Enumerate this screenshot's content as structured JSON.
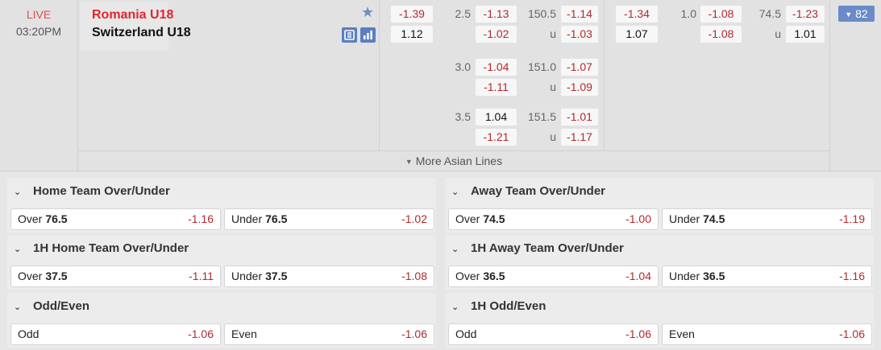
{
  "match": {
    "status": "LIVE",
    "time": "03:20PM",
    "home_team": "Romania U18",
    "away_team": "Switzerland U18",
    "total_markets": "82",
    "icons": [
      "star-icon",
      "scoreboard-icon",
      "stats-icon"
    ]
  },
  "full_time": {
    "moneyline": [
      "-1.39",
      "1.12"
    ],
    "handicap_lines": [
      {
        "line": "2.5",
        "home": "-1.13",
        "away": "-1.02"
      },
      {
        "line": "3.0",
        "home": "-1.04",
        "away": "-1.11"
      },
      {
        "line": "3.5",
        "home": "1.04",
        "away": "-1.21"
      }
    ],
    "total_lines": [
      {
        "line": "150.5",
        "over": "-1.14",
        "under_label": "u",
        "under": "-1.03"
      },
      {
        "line": "151.0",
        "over": "-1.07",
        "under_label": "u",
        "under": "-1.09"
      },
      {
        "line": "151.5",
        "over": "-1.01",
        "under_label": "u",
        "under": "-1.17"
      }
    ]
  },
  "first_half": {
    "moneyline": [
      "-1.34",
      "1.07"
    ],
    "handicap": {
      "line": "1.0",
      "home": "-1.08",
      "away": "-1.08"
    },
    "total": {
      "line": "74.5",
      "over": "-1.23",
      "under_label": "u",
      "under": "1.01"
    }
  },
  "more_asian_lines": "More Asian Lines",
  "markets": [
    {
      "title": "Home Team Over/Under",
      "selections": [
        {
          "name": "Over",
          "line": "76.5",
          "odd": "-1.16"
        },
        {
          "name": "Under",
          "line": "76.5",
          "odd": "-1.02"
        }
      ]
    },
    {
      "title": "Away Team Over/Under",
      "selections": [
        {
          "name": "Over",
          "line": "74.5",
          "odd": "-1.00"
        },
        {
          "name": "Under",
          "line": "74.5",
          "odd": "-1.19"
        }
      ]
    },
    {
      "title": "1H Home Team Over/Under",
      "selections": [
        {
          "name": "Over",
          "line": "37.5",
          "odd": "-1.11"
        },
        {
          "name": "Under",
          "line": "37.5",
          "odd": "-1.08"
        }
      ]
    },
    {
      "title": "1H Away Team Over/Under",
      "selections": [
        {
          "name": "Over",
          "line": "36.5",
          "odd": "-1.04"
        },
        {
          "name": "Under",
          "line": "36.5",
          "odd": "-1.16"
        }
      ]
    },
    {
      "title": "Odd/Even",
      "selections": [
        {
          "name": "Odd",
          "line": "",
          "odd": "-1.06"
        },
        {
          "name": "Even",
          "line": "",
          "odd": "-1.06"
        }
      ]
    },
    {
      "title": "1H Odd/Even",
      "selections": [
        {
          "name": "Odd",
          "line": "",
          "odd": "-1.06"
        },
        {
          "name": "Even",
          "line": "",
          "odd": "-1.06"
        }
      ]
    }
  ],
  "colors": {
    "negative_odd": "#b3292e",
    "accent": "#6a8bc8",
    "live": "#d9534f",
    "home_team": "#e0262d"
  }
}
